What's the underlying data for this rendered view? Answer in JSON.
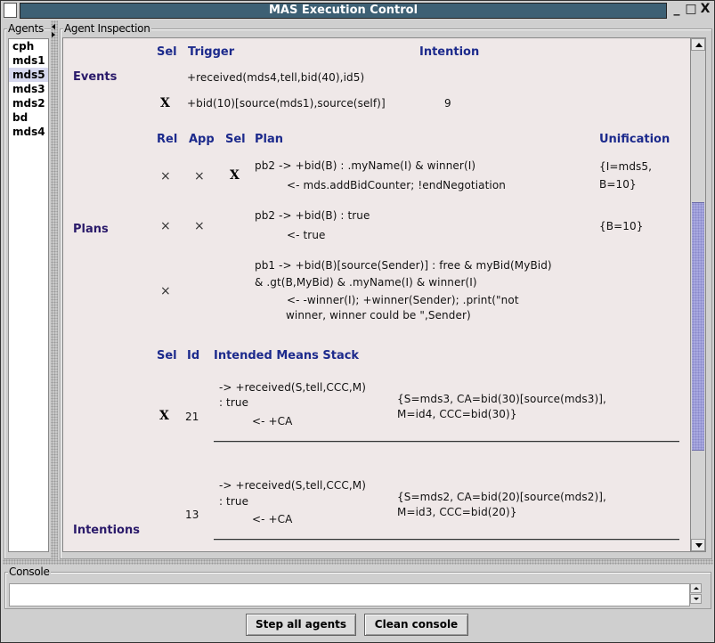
{
  "window": {
    "title": "MAS Execution Control",
    "controls": {
      "minimize": "_",
      "maximize": "□",
      "close": "X"
    }
  },
  "agents_panel": {
    "label": "Agents",
    "items": [
      "cph",
      "mds1",
      "mds5",
      "mds3",
      "mds2",
      "bd",
      "mds4"
    ],
    "selected": "mds5"
  },
  "inspection": {
    "label": "Agent Inspection",
    "events": {
      "section_label": "Events",
      "headers": {
        "sel": "Sel",
        "trigger": "Trigger",
        "intention": "Intention"
      },
      "rows": [
        {
          "sel": "",
          "trigger": "+received(mds4,tell,bid(40),id5)",
          "intention": ""
        },
        {
          "sel": "X",
          "trigger": "+bid(10)[source(mds1),source(self)]",
          "intention": "9"
        }
      ]
    },
    "plans": {
      "section_label": "Plans",
      "headers": {
        "rel": "Rel",
        "app": "App",
        "sel": "Sel",
        "plan": "Plan",
        "unification": "Unification"
      },
      "rows": [
        {
          "rel": "×",
          "app": "×",
          "sel": "X",
          "head": "pb2 -> +bid(B) : .myName(I) & winner(I)",
          "head2": "",
          "body": "<- mds.addBidCounter; !endNegotiation",
          "body2": "",
          "unification": "{I=mds5,",
          "unification2": "B=10}"
        },
        {
          "rel": "×",
          "app": "×",
          "sel": "",
          "head": "pb2 -> +bid(B) : true",
          "head2": "",
          "body": "<- true",
          "body2": "",
          "unification": "{B=10}",
          "unification2": ""
        },
        {
          "rel": "×",
          "app": "",
          "sel": "",
          "head": "pb1 -> +bid(B)[source(Sender)] : free & myBid(MyBid)",
          "head2": "& .gt(B,MyBid) & .myName(I) & winner(I)",
          "body": "<- -winner(I); +winner(Sender); .print(\"not",
          "body2": "winner, winner could be \",Sender)",
          "unification": "",
          "unification2": ""
        }
      ]
    },
    "intentions": {
      "section_label": "Intentions",
      "headers": {
        "sel": "Sel",
        "id": "Id",
        "stack": "Intended Means Stack"
      },
      "rows": [
        {
          "sel": "X",
          "id": "21",
          "trigger": "-> +received(S,tell,CCC,M)",
          "context": ": true",
          "body": "<- +CA",
          "unifier": "{S=mds3, CA=bid(30)[source(mds3)],",
          "unifier2": "M=id4, CCC=bid(30)}"
        },
        {
          "sel": "",
          "id": "13",
          "trigger": "-> +received(S,tell,CCC,M)",
          "context": ": true",
          "body": "<- +CA",
          "unifier": "{S=mds2, CA=bid(20)[source(mds2)],",
          "unifier2": "M=id3, CCC=bid(20)}"
        }
      ]
    },
    "scroll": {
      "position_fraction": 0.31,
      "visible_fraction": 0.51
    }
  },
  "console": {
    "label": "Console",
    "value": ""
  },
  "buttons": {
    "step_all": "Step all agents",
    "clean_console": "Clean console"
  },
  "colors": {
    "titlebar": "#3d6074",
    "header_text": "#1c2a8c",
    "section_text": "#2a1a6a",
    "inspect_bg": "#efe8e8",
    "list_selection": "#d6d8ee",
    "scroll_thumb": "#a8a8e0"
  }
}
